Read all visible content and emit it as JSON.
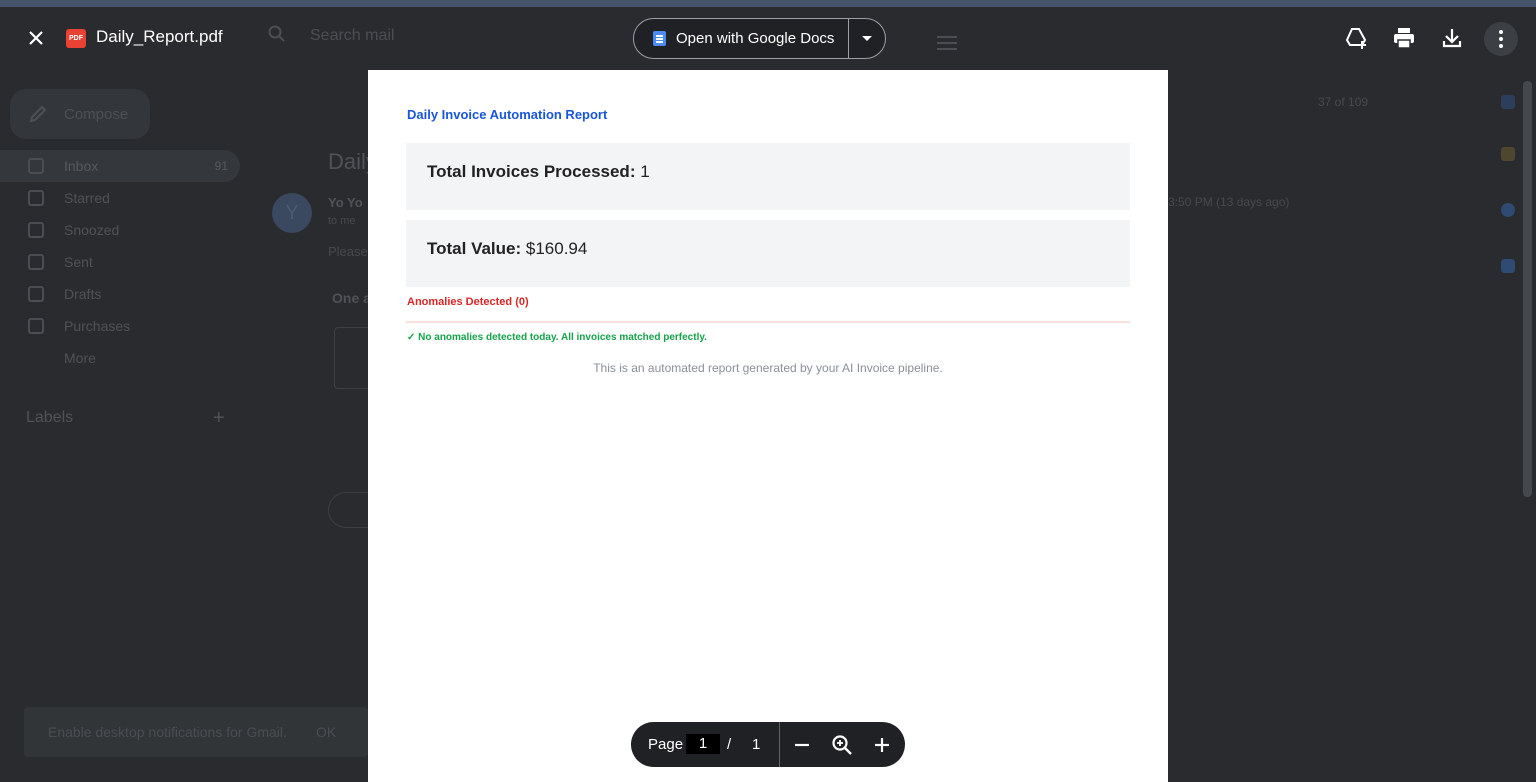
{
  "viewer": {
    "file_name": "Daily_Report.pdf",
    "pdf_badge": "PDF",
    "open_with_label": "Open with Google Docs"
  },
  "gmail_background": {
    "search_placeholder": "Search mail",
    "compose_label": "Compose",
    "nav": [
      {
        "label": "Inbox",
        "count": "91"
      },
      {
        "label": "Starred"
      },
      {
        "label": "Snoozed"
      },
      {
        "label": "Sent"
      },
      {
        "label": "Drafts"
      },
      {
        "label": "Purchases"
      },
      {
        "label": "More"
      }
    ],
    "labels_heading": "Labels",
    "toast_text": "Enable desktop notifications for Gmail.",
    "toast_ok": "OK",
    "email_subject": "Daily",
    "email_from": "Yo Yo",
    "email_to": "to me",
    "email_body": "Please",
    "attachment_heading": "One a",
    "avatar_letter": "Y",
    "counter": "37 of 109",
    "time": "3:50 PM (13 days ago)"
  },
  "report": {
    "title": "Daily Invoice Automation Report",
    "invoices_label": "Total Invoices Processed:",
    "invoices_value": "1",
    "value_label": "Total Value:",
    "value_amount": "$160.94",
    "anomalies_heading": "Anomalies Detected (0)",
    "anomalies_message": "✓ No anomalies detected today. All invoices matched perfectly.",
    "footer": "This is an automated report generated by your AI Invoice pipeline."
  },
  "page_controls": {
    "page_label": "Page",
    "current_page": "1",
    "separator": "/",
    "total_pages": "1"
  },
  "colors": {
    "report_title": "#1a56db",
    "anomalies": "#dc2626",
    "success": "#16a34a",
    "pdf_badge": "#e94235",
    "docs_icon": "#4c8bf5"
  }
}
